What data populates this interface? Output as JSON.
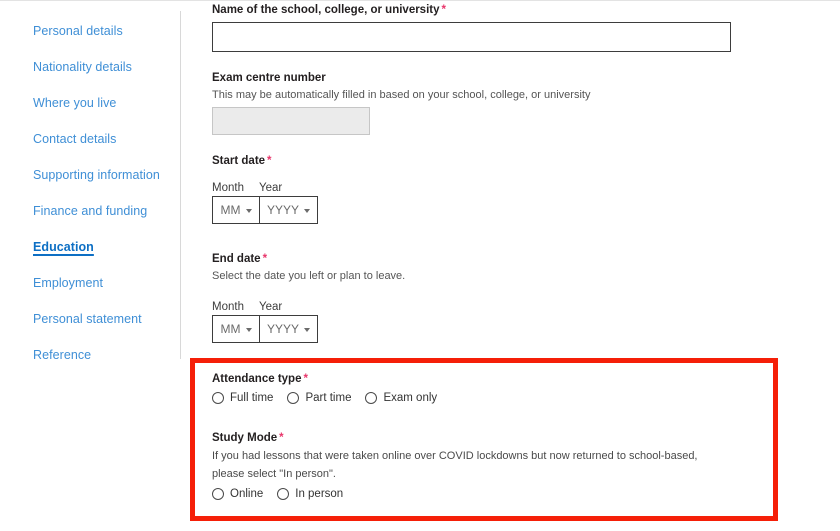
{
  "sidebar": {
    "items": [
      {
        "label": "Personal details",
        "active": false
      },
      {
        "label": "Nationality details",
        "active": false
      },
      {
        "label": "Where you live",
        "active": false
      },
      {
        "label": "Contact details",
        "active": false
      },
      {
        "label": "Supporting information",
        "active": false
      },
      {
        "label": "Finance and funding",
        "active": false
      },
      {
        "label": "Education",
        "active": true
      },
      {
        "label": "Employment",
        "active": false
      },
      {
        "label": "Personal statement",
        "active": false
      },
      {
        "label": "Reference",
        "active": false
      }
    ]
  },
  "form": {
    "school_name": {
      "label": "Name of the school, college, or university",
      "required_marker": "*",
      "value": "",
      "placeholder": ""
    },
    "exam_centre": {
      "label": "Exam centre number",
      "hint": "This may be automatically filled in based on your school, college, or university",
      "value": "",
      "placeholder": ""
    },
    "start_date": {
      "label": "Start date",
      "required_marker": "*",
      "month_label": "Month",
      "year_label": "Year",
      "month_value": "MM",
      "year_value": "YYYY"
    },
    "end_date": {
      "label": "End date",
      "required_marker": "*",
      "hint": "Select the date you left or plan to leave.",
      "month_label": "Month",
      "year_label": "Year",
      "month_value": "MM",
      "year_value": "YYYY"
    },
    "attendance_type": {
      "label": "Attendance type",
      "required_marker": "*",
      "options": [
        "Full time",
        "Part time",
        "Exam only"
      ],
      "selected": ""
    },
    "study_mode": {
      "label": "Study Mode",
      "required_marker": "*",
      "description": "If you had lessons that were taken online over COVID lockdowns but now returned to school-based, please select \"In person\".",
      "options": [
        "Online",
        "In person"
      ],
      "selected": ""
    }
  },
  "highlight": {
    "color": "#f51f08"
  }
}
